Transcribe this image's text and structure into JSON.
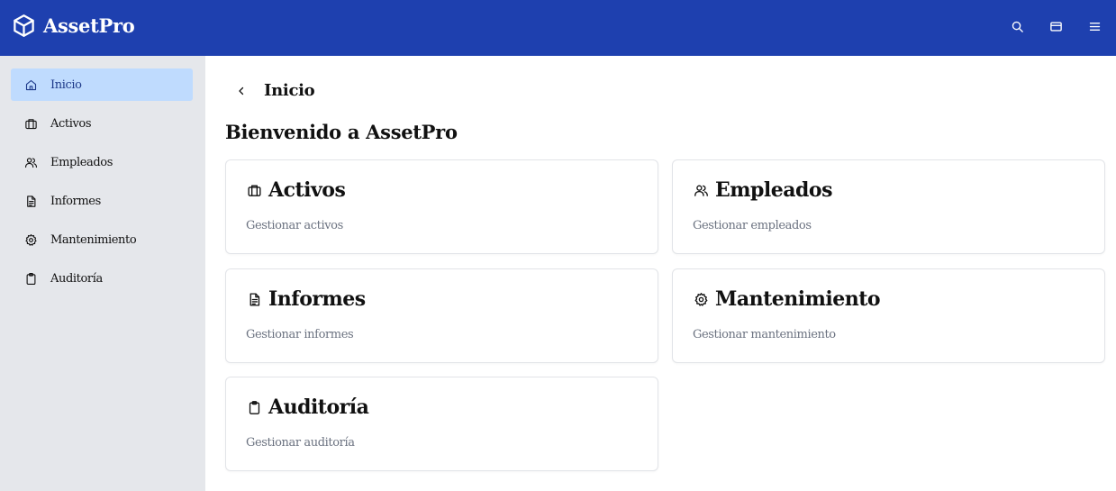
{
  "header": {
    "brand": "AssetPro",
    "brand_icon": "cube-icon",
    "bg_color": "#1e40af",
    "actions": [
      {
        "icon": "search-icon"
      },
      {
        "icon": "credit-card-icon"
      },
      {
        "icon": "menu-icon"
      }
    ]
  },
  "sidebar": {
    "bg_color": "#e5e7eb",
    "active_color": "#bfdbfe",
    "items": [
      {
        "label": "Inicio",
        "icon": "home-icon",
        "active": true
      },
      {
        "label": "Activos",
        "icon": "briefcase-icon",
        "active": false
      },
      {
        "label": "Empleados",
        "icon": "users-icon",
        "active": false
      },
      {
        "label": "Informes",
        "icon": "file-text-icon",
        "active": false
      },
      {
        "label": "Mantenimiento",
        "icon": "gear-icon",
        "active": false
      },
      {
        "label": "Auditoría",
        "icon": "clipboard-icon",
        "active": false
      }
    ]
  },
  "main": {
    "breadcrumb": {
      "back_icon": "chevron-left-icon",
      "title": "Inicio"
    },
    "page_title": "Bienvenido a AssetPro",
    "cards": [
      {
        "title": "Activos",
        "description": "Gestionar activos",
        "icon": "briefcase-icon"
      },
      {
        "title": "Empleados",
        "description": "Gestionar empleados",
        "icon": "users-icon"
      },
      {
        "title": "Informes",
        "description": "Gestionar informes",
        "icon": "file-text-icon"
      },
      {
        "title": "Mantenimiento",
        "description": "Gestionar mantenimiento",
        "icon": "gear-icon"
      },
      {
        "title": "Auditoría",
        "description": "Gestionar auditoría",
        "icon": "clipboard-icon"
      }
    ]
  }
}
